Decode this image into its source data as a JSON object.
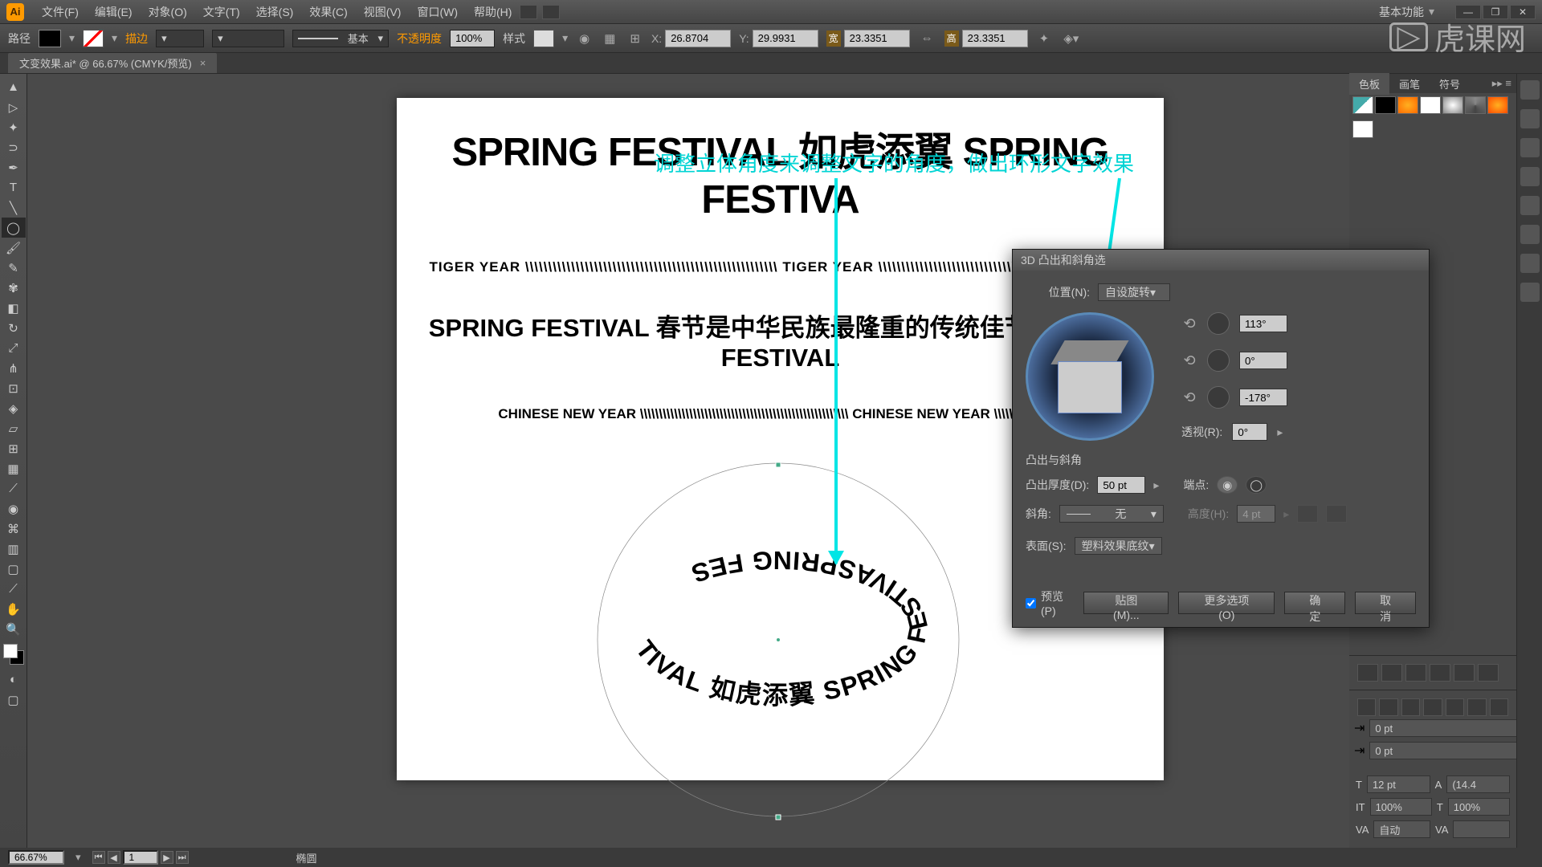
{
  "menubar": {
    "app": "Ai",
    "items": [
      "文件(F)",
      "编辑(E)",
      "对象(O)",
      "文字(T)",
      "选择(S)",
      "效果(C)",
      "视图(V)",
      "窗口(W)",
      "帮助(H)"
    ],
    "workspace": "基本功能"
  },
  "controlbar": {
    "path": "路径",
    "stroke": "描边",
    "basic": "基本",
    "opacity_label": "不透明度",
    "opacity": "100%",
    "style": "样式",
    "x": "26.8704",
    "y": "29.9931",
    "w": "23.3351",
    "h": "23.3351"
  },
  "doctab": {
    "name": "文变效果.ai* @ 66.67% (CMYK/预览)"
  },
  "artboard": {
    "h1": "SPRING FESTIVAL 如虎添翼 SPRING FESTIVA",
    "line2": "TIGER YEAR \\\\\\\\\\\\\\\\\\\\\\\\\\\\\\\\\\\\\\\\\\\\\\\\\\\\\\\\\\\\\\\\\\\\\\\\\\\\\\\\\\\\\\\\\\\\\\\\\\\\\\\\\\\\\\ TIGER YEAR \\\\\\\\\\\\\\\\\\\\\\\\\\\\\\\\\\\\\\\\\\\\\\\\\\\\\\\\\\\\\\\\\\\\\\\\\\\\\\\\\\\\\\\\\\\\\\\\\\\\\\\\\\\\\\",
    "line3": "SPRING FESTIVAL 春节是中华民族最隆重的传统佳节 SPRING FESTIVAL",
    "line4": "CHINESE NEW YEAR \\\\\\\\\\\\\\\\\\\\\\\\\\\\\\\\\\\\\\\\\\\\\\\\\\\\\\\\\\\\\\\\\\\\\\\\\\\\\\\\\\\\\\\\\\\\\\\\\\\\\\\\\\\\\\ CHINESE NEW YEAR \\\\\\\\\\\\\\\\\\\\\\\\\\\\\\\\\\\\"
  },
  "annotation": "调整立体角度来调整文字的角度，做出环形文字效果",
  "bg_text": "NG FESTIVAL",
  "dialog": {
    "title": "3D 凸出和斜角选",
    "position_label": "位置(N):",
    "position_value": "自设旋转",
    "rot_x": "113°",
    "rot_y": "0°",
    "rot_z": "-178°",
    "perspective_label": "透视(R):",
    "perspective": "0°",
    "section": "凸出与斜角",
    "depth_label": "凸出厚度(D):",
    "depth": "50 pt",
    "cap_label": "端点:",
    "bevel_label": "斜角:",
    "bevel_value": "无",
    "height_label": "高度(H):",
    "height": "4 pt",
    "surface_label": "表面(S):",
    "surface_value": "塑料效果底纹",
    "preview": "预览(P)",
    "map": "贴图(M)...",
    "more": "更多选项(O)",
    "ok": "确定",
    "cancel": "取消"
  },
  "panels": {
    "tabs": [
      "色板",
      "画笔",
      "符号"
    ],
    "char": {
      "size": "12 pt",
      "leading": "(14.4",
      "hscale": "100%",
      "vscale": "100%",
      "tracking": "自动",
      "indent1": "0 pt",
      "indent2": "0 pt"
    }
  },
  "swatches": [
    {
      "bg": "linear-gradient(135deg,#4aa 50%,#fff 50%)"
    },
    {
      "bg": "#000"
    },
    {
      "bg": "radial-gradient(#ffb020,#ff6a00)"
    },
    {
      "bg": "#fff"
    },
    {
      "bg": "radial-gradient(#fff,#888)"
    },
    {
      "bg": "conic-gradient(#888,#444,#888)"
    },
    {
      "bg": "radial-gradient(#ffb020,#ff4a00)"
    }
  ],
  "status": {
    "zoom": "66.67%",
    "page": "1",
    "tool": "椭圆"
  },
  "watermark": "虎课网"
}
